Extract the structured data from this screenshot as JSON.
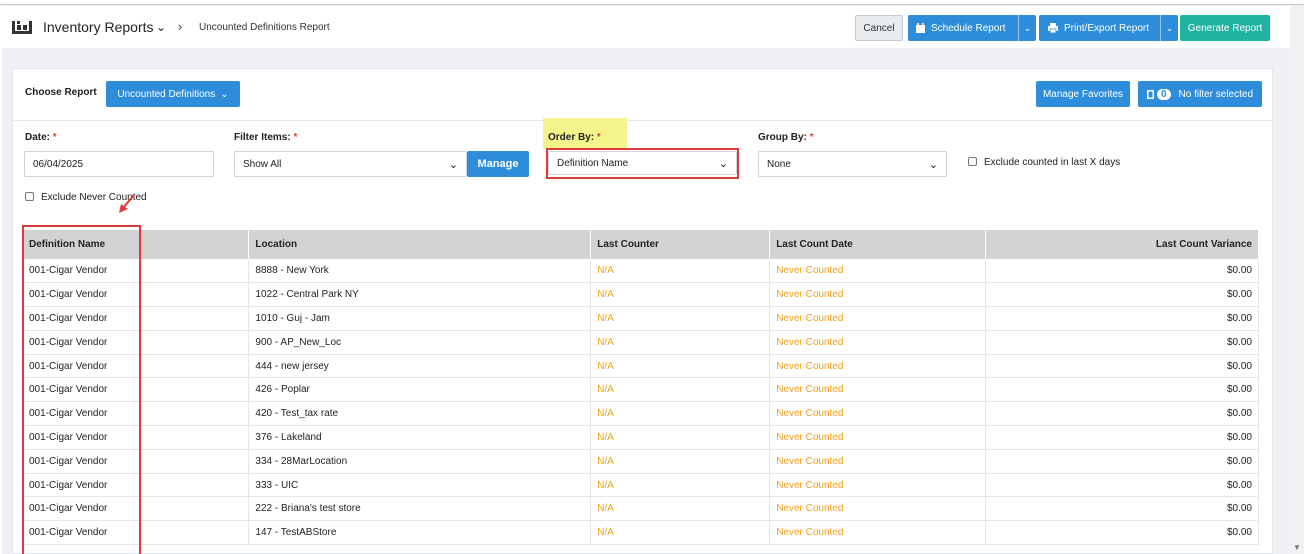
{
  "header": {
    "app_title": "Inventory Reports",
    "breadcrumb": "Uncounted Definitions Report",
    "cancel_label": "Cancel",
    "schedule_label": "Schedule Report",
    "print_label": "Print/Export Report",
    "generate_label": "Generate Report"
  },
  "report": {
    "choose_label": "Choose Report",
    "selected_report": "Uncounted Definitions",
    "manage_favorites_label": "Manage Favorites",
    "filter_count": "0",
    "filter_status": "No filter selected"
  },
  "filters": {
    "date_label": "Date:",
    "date_value": "06/04/2025",
    "filter_items_label": "Filter Items:",
    "filter_items_value": "Show All",
    "manage_label": "Manage",
    "order_by_label": "Order By:",
    "order_by_value": "Definition Name",
    "group_by_label": "Group By:",
    "group_by_value": "None",
    "exclude_counted_label": "Exclude counted in last X days",
    "exclude_never_label": "Exclude Never Counted",
    "required_mark": "*"
  },
  "table": {
    "columns": [
      "Definition Name",
      "Location",
      "Last Counter",
      "Last Count Date",
      "Last Count Variance"
    ],
    "rows": [
      [
        "001-Cigar Vendor",
        "8888 - New York",
        "N/A",
        "Never Counted",
        "$0.00"
      ],
      [
        "001-Cigar Vendor",
        "1022 - Central Park NY",
        "N/A",
        "Never Counted",
        "$0.00"
      ],
      [
        "001-Cigar Vendor",
        "1010 - Guj - Jam",
        "N/A",
        "Never Counted",
        "$0.00"
      ],
      [
        "001-Cigar Vendor",
        "900 - AP_New_Loc",
        "N/A",
        "Never Counted",
        "$0.00"
      ],
      [
        "001-Cigar Vendor",
        "444 - new jersey",
        "N/A",
        "Never Counted",
        "$0.00"
      ],
      [
        "001-Cigar Vendor",
        "426 - Poplar",
        "N/A",
        "Never Counted",
        "$0.00"
      ],
      [
        "001-Cigar Vendor",
        "420 - Test_tax rate",
        "N/A",
        "Never Counted",
        "$0.00"
      ],
      [
        "001-Cigar Vendor",
        "376 - Lakeland",
        "N/A",
        "Never Counted",
        "$0.00"
      ],
      [
        "001-Cigar Vendor",
        "334 - 28MarLocation",
        "N/A",
        "Never Counted",
        "$0.00"
      ],
      [
        "001-Cigar Vendor",
        "333 - UIC",
        "N/A",
        "Never Counted",
        "$0.00"
      ],
      [
        "001-Cigar Vendor",
        "222 - Briana's test store",
        "N/A",
        "Never Counted",
        "$0.00"
      ],
      [
        "001-Cigar Vendor",
        "147 - TestABStore",
        "N/A",
        "Never Counted",
        "$0.00"
      ]
    ]
  },
  "colors": {
    "primary_blue": "#2e8ddb",
    "teal": "#21b3a2",
    "orange_text": "#f0a11c",
    "annotation_red": "#e03b3b",
    "highlight_yellow": "#f3f58b"
  },
  "icons": [
    "inventory-report-icon",
    "chevron-down-icon",
    "chevron-right-icon",
    "calendar-icon",
    "printer-icon",
    "filter-icon"
  ]
}
